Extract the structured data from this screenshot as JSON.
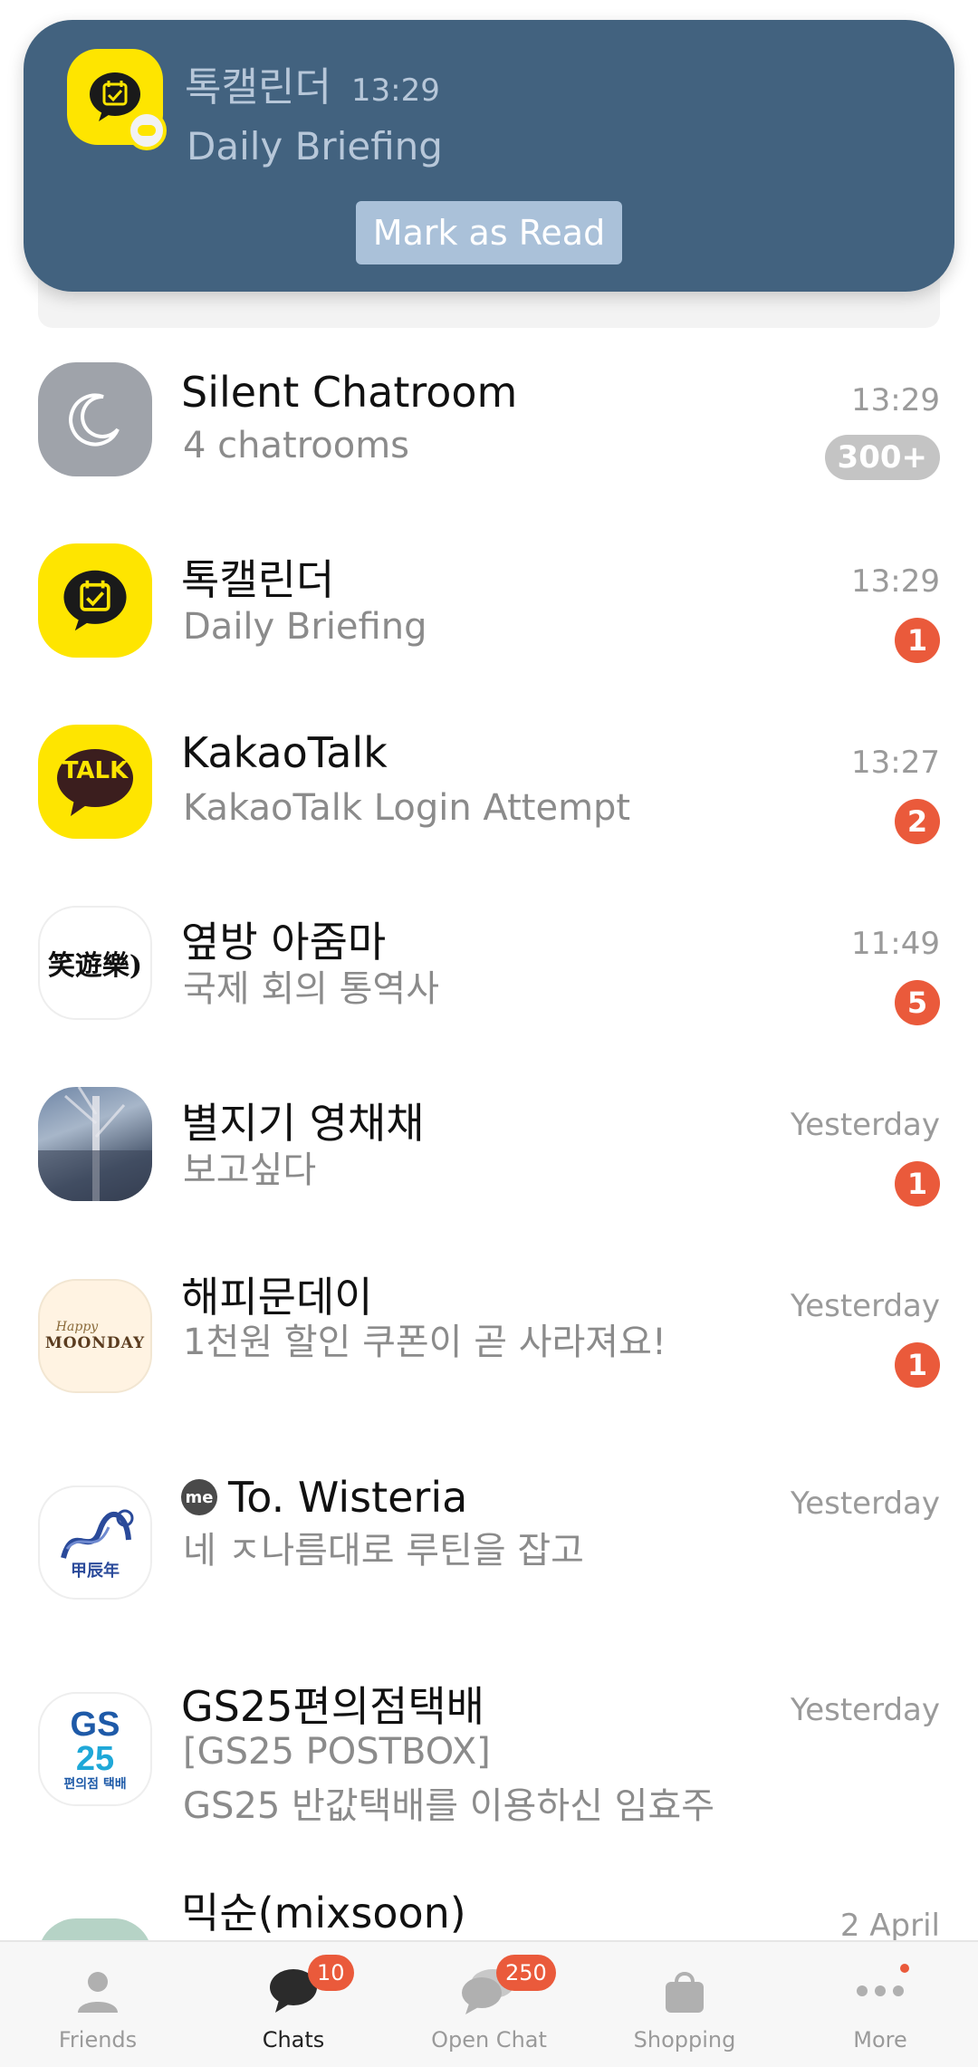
{
  "notification": {
    "app_name": "톡캘린더",
    "time": "13:29",
    "body": "Daily Briefing",
    "action_label": "Mark as Read"
  },
  "chats": [
    {
      "name": "Silent Chatroom",
      "preview": "4 chatrooms",
      "time": "13:29",
      "badge": "300+",
      "avatar_icon": "moon-icon"
    },
    {
      "name": "톡캘린더",
      "preview": "Daily Briefing",
      "time": "13:29",
      "badge": "1",
      "avatar_icon": "calendar-check-icon"
    },
    {
      "name": "KakaoTalk",
      "preview": "KakaoTalk Login Attempt",
      "time": "13:27",
      "badge": "2",
      "avatar_icon": "talk-logo-icon",
      "avatar_text": "TALK"
    },
    {
      "name": "옆방 아줌마",
      "preview": "국제 회의 통역사",
      "time": "11:49",
      "badge": "5",
      "avatar_text": "笑遊樂)"
    },
    {
      "name": "별지기 영채채",
      "preview": "보고싶다",
      "time": "Yesterday",
      "badge": "1",
      "avatar_icon": "photo-avatar"
    },
    {
      "name": "해피문데이",
      "preview": "1천원 할인 쿠폰이 곧 사라져요!",
      "time": "Yesterday",
      "badge": "1",
      "avatar_text": "MOONDAY",
      "avatar_script": "Happy"
    },
    {
      "name": "To. Wisteria",
      "me_label": "me",
      "preview": "네 ㅈ나름대로 루틴을 잡고",
      "time": "Yesterday",
      "avatar_icon": "dragon-icon",
      "avatar_text": "甲辰年"
    },
    {
      "name": "GS25편의점택배",
      "preview": "[GS25 POSTBOX]",
      "preview2": "GS25 반값택배를 이용하신 임효주",
      "time": "Yesterday",
      "avatar_text": "GS",
      "avatar_text2": "25",
      "avatar_text3": "편의점 택배"
    },
    {
      "name": "믹순(mixsoon)",
      "time": "2 April"
    }
  ],
  "tabs": [
    {
      "label": "Friends",
      "icon": "person-icon"
    },
    {
      "label": "Chats",
      "icon": "chat-bubble-icon",
      "badge": "10"
    },
    {
      "label": "Open Chat",
      "icon": "open-chat-icon",
      "badge": "250"
    },
    {
      "label": "Shopping",
      "icon": "shopping-bag-icon"
    },
    {
      "label": "More",
      "icon": "more-dots-icon"
    }
  ],
  "colors": {
    "notification_bg": "#42627f",
    "badge": "#ea5a3b",
    "kakao_yellow": "#fee500"
  }
}
